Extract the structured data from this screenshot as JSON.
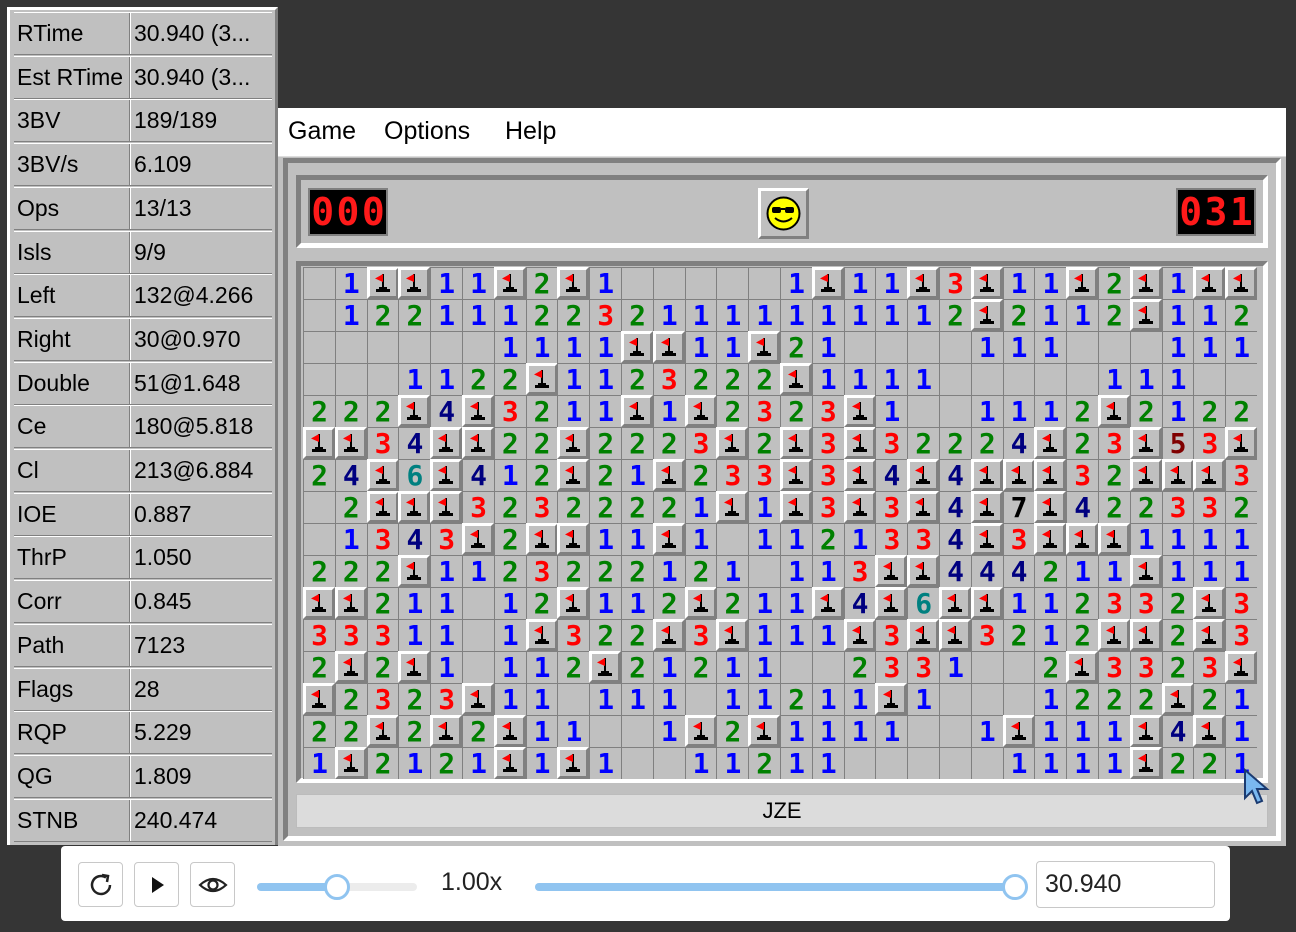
{
  "stats": [
    {
      "label": "RTime",
      "value": "30.940 (3..."
    },
    {
      "label": "Est RTime",
      "value": "30.940 (3..."
    },
    {
      "label": "3BV",
      "value": "189/189"
    },
    {
      "label": "3BV/s",
      "value": "6.109"
    },
    {
      "label": "Ops",
      "value": "13/13"
    },
    {
      "label": "Isls",
      "value": "9/9"
    },
    {
      "label": "Left",
      "value": "132@4.266"
    },
    {
      "label": "Right",
      "value": "30@0.970"
    },
    {
      "label": "Double",
      "value": "51@1.648"
    },
    {
      "label": "Ce",
      "value": "180@5.818"
    },
    {
      "label": "Cl",
      "value": "213@6.884"
    },
    {
      "label": "IOE",
      "value": "0.887"
    },
    {
      "label": "ThrP",
      "value": "1.050"
    },
    {
      "label": "Corr",
      "value": "0.845"
    },
    {
      "label": "Path",
      "value": "7123"
    },
    {
      "label": "Flags",
      "value": "28"
    },
    {
      "label": "RQP",
      "value": "5.229"
    },
    {
      "label": "QG",
      "value": "1.809"
    },
    {
      "label": "STNB",
      "value": "240.474"
    }
  ],
  "menu": {
    "game": "Game",
    "options": "Options",
    "help": "Help"
  },
  "counters": {
    "mines_left": "000",
    "timer": "031"
  },
  "board": {
    "rows": [
      ".1FF11F2F1.....1F11F3F11F2F1FF",
      ".12211122321111111112F2112F1122",
      "......1111FF11F21....111...111",
      "...1122F1123222F1111.....111..",
      "222F4F3211F1F2323F1..1112F2122",
      "FF34FF22F2223F2F3F32224F23F53FF",
      "24F6F412F21F233F3F4F4FFF32FFF32",
      ".2FFF32322221F1F3F3F4F7F4223321",
      ".1343F2FF11F1.1121334F3FFF1111",
      "222F1123222121.113FF444211F111",
      "FF211.12F112F211F4F6FF112332F3F",
      "33311.1F322F3F111F3FF3212FF2F3F",
      "2F2F1.112F21211..2331..2F3323F1",
      "F2323F11.111.11211F1...1222F21",
      "22F2F2F11..1F2F1111..1F111F4F1",
      "1F2121F1F1..11211.....1111F221"
    ],
    "number_colors": {
      "1": "#0000ff",
      "2": "#008000",
      "3": "#ff0000",
      "4": "#000080",
      "5": "#800000",
      "6": "#008080",
      "7": "#000000",
      "8": "#808080"
    }
  },
  "player_name": "JZE",
  "playback": {
    "speed_label": "1.00x",
    "time_value": "30.940",
    "speed_fraction": 0.5,
    "progress_fraction": 1.0
  },
  "icons": {
    "reset": "refresh-icon",
    "play": "play-icon",
    "view": "eye-icon",
    "face": "sunglasses-smiley-icon",
    "cursor": "mouse-pointer-icon",
    "flag": "flag-icon"
  },
  "colors": {
    "accent": "#90c4f0",
    "board_bg": "#c0c0c0",
    "lcd_digit": "#ff1a1a"
  }
}
